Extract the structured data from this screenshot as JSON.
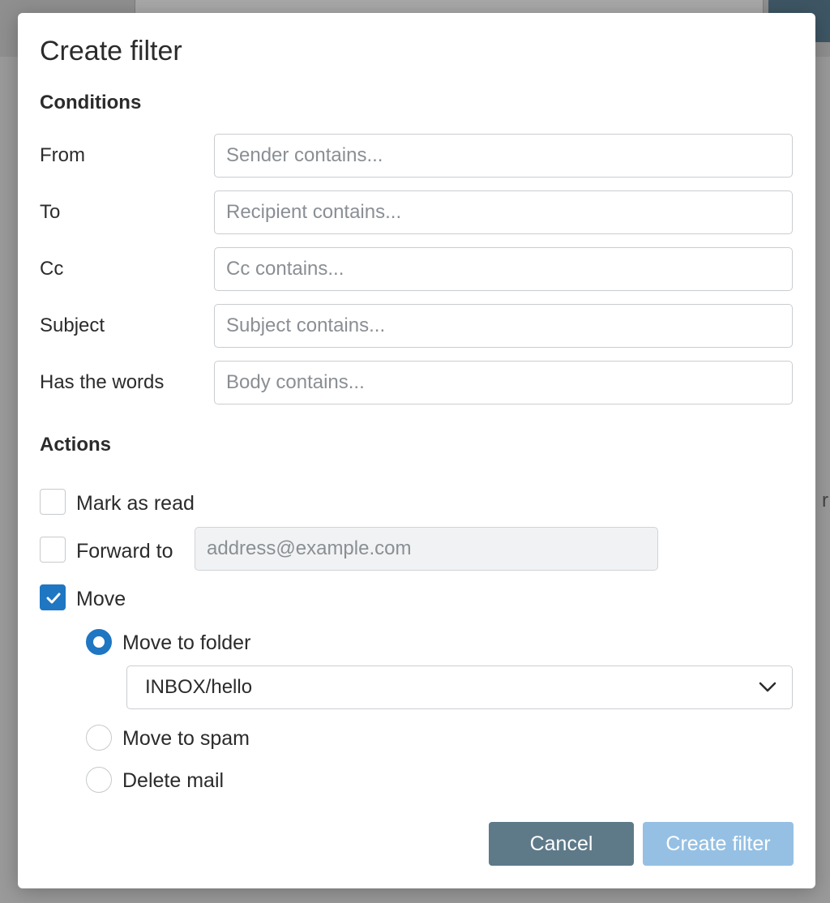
{
  "modal": {
    "title": "Create filter"
  },
  "conditions": {
    "heading": "Conditions",
    "fields": [
      {
        "label": "From",
        "placeholder": "Sender contains...",
        "value": ""
      },
      {
        "label": "To",
        "placeholder": "Recipient contains...",
        "value": ""
      },
      {
        "label": "Cc",
        "placeholder": "Cc contains...",
        "value": ""
      },
      {
        "label": "Subject",
        "placeholder": "Subject contains...",
        "value": ""
      },
      {
        "label": "Has the words",
        "placeholder": "Body contains...",
        "value": ""
      }
    ]
  },
  "actions": {
    "heading": "Actions",
    "mark_as_read": {
      "label": "Mark as read",
      "checked": false
    },
    "forward_to": {
      "label": "Forward to",
      "checked": false,
      "placeholder": "address@example.com",
      "value": ""
    },
    "move": {
      "label": "Move",
      "checked": true,
      "options": [
        {
          "label": "Move to folder",
          "selected": true
        },
        {
          "label": "Move to spam",
          "selected": false
        },
        {
          "label": "Delete mail",
          "selected": false
        }
      ],
      "folder_select": {
        "value": "INBOX/hello"
      }
    }
  },
  "buttons": {
    "cancel": "Cancel",
    "create": "Create filter"
  },
  "colors": {
    "accent": "#1f76c2",
    "cancel_bg": "#5e7a89",
    "create_bg_disabled": "#95c0e3"
  },
  "icons": {
    "checkmark": "checkmark-icon",
    "chevron": "chevron-down-icon"
  }
}
